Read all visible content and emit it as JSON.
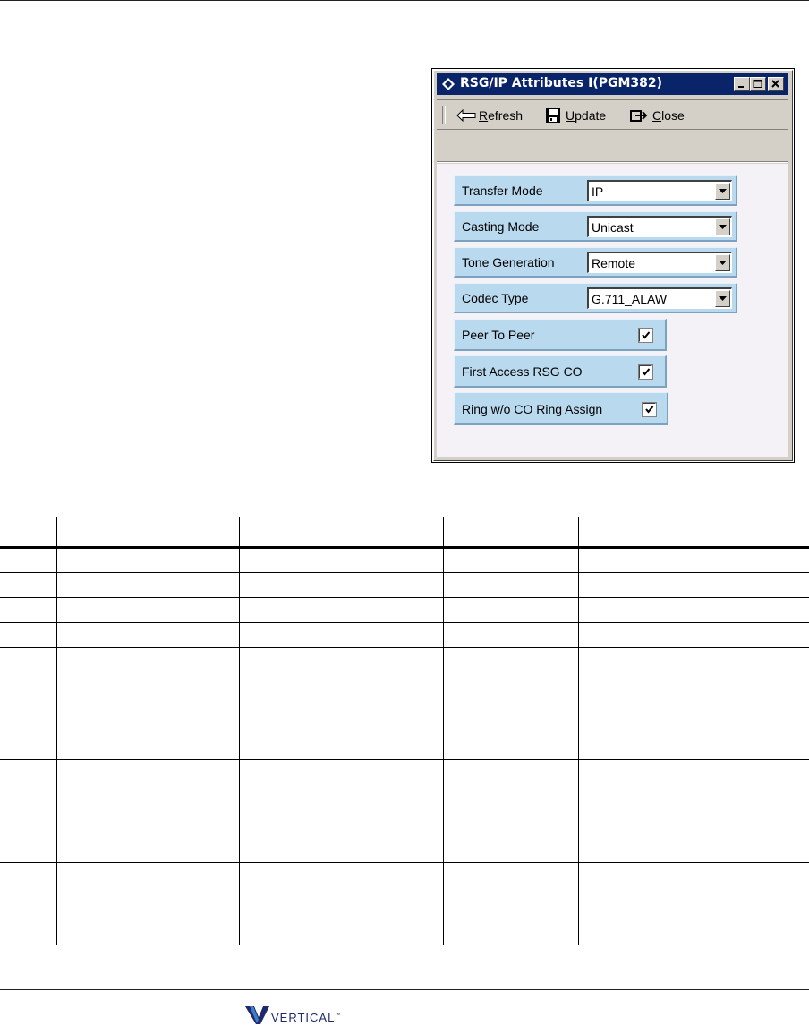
{
  "window": {
    "title": "RSG/IP Attributes I(PGM382)",
    "title_bar_color": "#0a246a",
    "toolbar": {
      "refresh_prefix": "",
      "refresh_accel": "R",
      "refresh_rest": "efresh",
      "update_accel": "U",
      "update_rest": "pdate",
      "close_accel": "C",
      "close_rest": "lose"
    },
    "fields": [
      {
        "label": "Transfer Mode",
        "value": "IP"
      },
      {
        "label": "Casting Mode",
        "value": "Unicast"
      },
      {
        "label": "Tone Generation",
        "value": "Remote"
      },
      {
        "label": "Codec Type",
        "value": "G.711_ALAW"
      }
    ],
    "checkboxes": [
      {
        "label": "Peer To Peer",
        "checked": true
      },
      {
        "label": "First Access RSG CO",
        "checked": true
      },
      {
        "label": "Ring w/o CO Ring Assign",
        "checked": true
      }
    ],
    "label_color": "#b9d9ee"
  },
  "footer": {
    "logo_text": "VERTICAL",
    "logo_mark": "™",
    "brand_color": "#1f2a6e"
  }
}
